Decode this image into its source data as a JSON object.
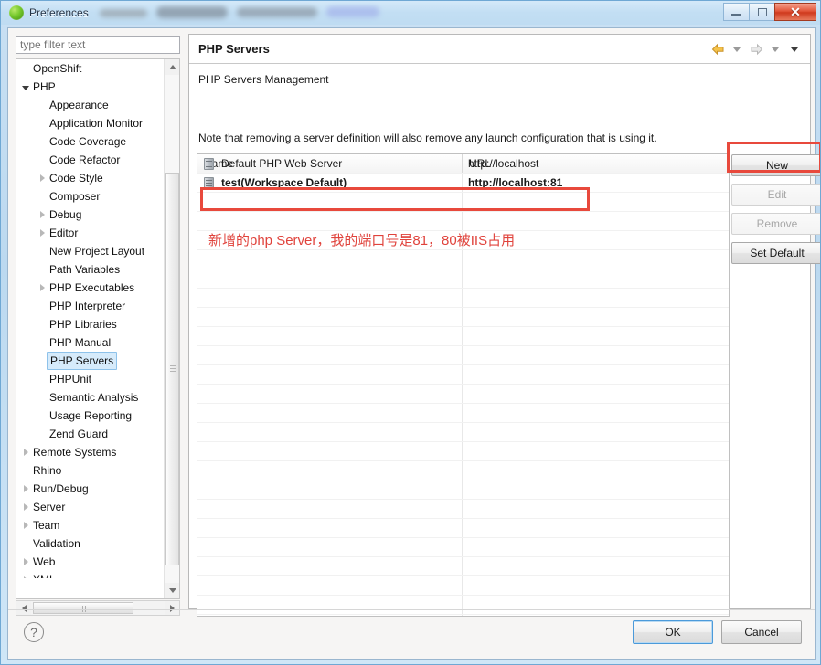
{
  "window": {
    "title": "Preferences",
    "icon": "app-green-sphere-icon",
    "controls": {
      "minimize": "minimize-icon",
      "maximize": "maximize-icon",
      "close": "close-icon"
    }
  },
  "filter": {
    "placeholder": "type filter text",
    "value": ""
  },
  "tree": {
    "items": [
      {
        "label": "OpenShift",
        "level": 0,
        "arrow": "none",
        "selected": false
      },
      {
        "label": "PHP",
        "level": 0,
        "arrow": "expanded",
        "selected": false
      },
      {
        "label": "Appearance",
        "level": 1,
        "arrow": "none",
        "selected": false
      },
      {
        "label": "Application Monitor",
        "level": 1,
        "arrow": "none",
        "selected": false
      },
      {
        "label": "Code Coverage",
        "level": 1,
        "arrow": "none",
        "selected": false
      },
      {
        "label": "Code Refactor",
        "level": 1,
        "arrow": "none",
        "selected": false
      },
      {
        "label": "Code Style",
        "level": 1,
        "arrow": "collapsed",
        "selected": false
      },
      {
        "label": "Composer",
        "level": 1,
        "arrow": "none",
        "selected": false
      },
      {
        "label": "Debug",
        "level": 1,
        "arrow": "collapsed",
        "selected": false
      },
      {
        "label": "Editor",
        "level": 1,
        "arrow": "collapsed",
        "selected": false
      },
      {
        "label": "New Project Layout",
        "level": 1,
        "arrow": "none",
        "selected": false
      },
      {
        "label": "Path Variables",
        "level": 1,
        "arrow": "none",
        "selected": false
      },
      {
        "label": "PHP Executables",
        "level": 1,
        "arrow": "collapsed",
        "selected": false
      },
      {
        "label": "PHP Interpreter",
        "level": 1,
        "arrow": "none",
        "selected": false
      },
      {
        "label": "PHP Libraries",
        "level": 1,
        "arrow": "none",
        "selected": false
      },
      {
        "label": "PHP Manual",
        "level": 1,
        "arrow": "none",
        "selected": false
      },
      {
        "label": "PHP Servers",
        "level": 1,
        "arrow": "none",
        "selected": true
      },
      {
        "label": "PHPUnit",
        "level": 1,
        "arrow": "none",
        "selected": false
      },
      {
        "label": "Semantic Analysis",
        "level": 1,
        "arrow": "none",
        "selected": false
      },
      {
        "label": "Usage Reporting",
        "level": 1,
        "arrow": "none",
        "selected": false
      },
      {
        "label": "Zend Guard",
        "level": 1,
        "arrow": "none",
        "selected": false
      },
      {
        "label": "Remote Systems",
        "level": 0,
        "arrow": "collapsed",
        "selected": false
      },
      {
        "label": "Rhino",
        "level": 0,
        "arrow": "none",
        "selected": false
      },
      {
        "label": "Run/Debug",
        "level": 0,
        "arrow": "collapsed",
        "selected": false
      },
      {
        "label": "Server",
        "level": 0,
        "arrow": "collapsed",
        "selected": false
      },
      {
        "label": "Team",
        "level": 0,
        "arrow": "collapsed",
        "selected": false
      },
      {
        "label": "Validation",
        "level": 0,
        "arrow": "none",
        "selected": false
      },
      {
        "label": "Web",
        "level": 0,
        "arrow": "collapsed",
        "selected": false
      },
      {
        "label": "XML",
        "level": 0,
        "arrow": "collapsed",
        "selected": false
      }
    ]
  },
  "page": {
    "title": "PHP Servers",
    "subtitle": "PHP Servers Management",
    "note": "Note that removing a server definition will also remove any launch configuration that is using it.",
    "nav": {
      "back": "back-arrow-icon",
      "back_menu": "chevron-down-icon",
      "forward": "forward-arrow-icon",
      "forward_menu": "chevron-down-icon",
      "view_menu": "chevron-down-icon"
    }
  },
  "table": {
    "columns": [
      "Name",
      "URL"
    ],
    "rows": [
      {
        "name": "Default PHP Web Server",
        "url": "http://localhost",
        "bold": false,
        "highlighted": false
      },
      {
        "name": "test(Workspace Default)",
        "url": "http://localhost:81",
        "bold": true,
        "highlighted": true
      }
    ]
  },
  "annotation": {
    "text": "新增的php Server，我的端口号是81，80被IIS占用",
    "color": "#e0433c"
  },
  "side_buttons": [
    {
      "label": "New",
      "enabled": true,
      "highlighted": true
    },
    {
      "label": "Edit",
      "enabled": false,
      "highlighted": false
    },
    {
      "label": "Remove",
      "enabled": false,
      "highlighted": false
    },
    {
      "label": "Set Default",
      "enabled": true,
      "highlighted": false
    }
  ],
  "footer": {
    "help": "help-icon",
    "ok": "OK",
    "cancel": "Cancel"
  }
}
